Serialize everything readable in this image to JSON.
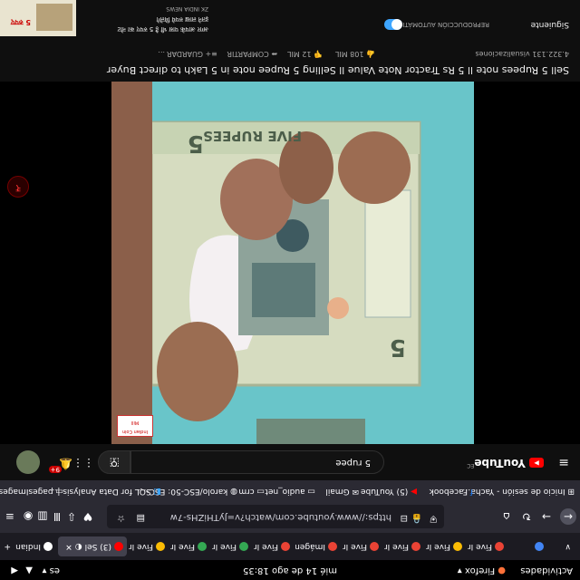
{
  "topbar": {
    "activities": "Actividades",
    "app_name": "Firefox",
    "clock": "mié 14 de ago  18:35",
    "keyboard": "es"
  },
  "tabs": [
    {
      "label": "Five India",
      "color": "#ea4335"
    },
    {
      "label": "Five India",
      "color": "#fbbc04"
    },
    {
      "label": "Five India",
      "color": "#ea4335"
    },
    {
      "label": "Five India",
      "color": "#ea4335"
    },
    {
      "label": "Imágenes",
      "color": "#ea4335"
    },
    {
      "label": "Five India",
      "color": "#ea4335"
    },
    {
      "label": "Five India",
      "color": "#34a853"
    },
    {
      "label": "Five India",
      "color": "#34a853"
    },
    {
      "label": "Five India",
      "color": "#fbbc04"
    },
    {
      "label": "(3) Sel",
      "color": "#ff0000"
    },
    {
      "label": "Indian rupee",
      "color": "#ffffff"
    }
  ],
  "navbar": {
    "url": "https://www.youtube.com/watch?v=JyTHiZHs-7w"
  },
  "bookmarks": [
    "Inicio de sesión - Yacha…",
    "Facebook",
    "(5) YouTube",
    "Gmail",
    "audio_net",
    "crm",
    "karolo/ESC-50: ESC-…",
    "SQL for Data Analysis |…",
    "pagesImages"
  ],
  "youtube": {
    "logo": "YouTube",
    "country": "EC",
    "search_value": "5 rupee",
    "notification_count": "9+"
  },
  "video": {
    "watermark": "Indian Coin Mill",
    "note_text": "FIVE RUPEES",
    "note_numeral": "5",
    "title": "Sell 5 Rupees note ll 5 Rs Tractor Note Value ll Selling 5 Rupee note in 5 Lakh to direct Buyer",
    "views": "4.322.131 visualizaciones",
    "likes": "108 MIL",
    "dislikes": "12 MIL",
    "share": "COMPARTIR",
    "save": "GUARDAR",
    "more": "..."
  },
  "sidebar": {
    "next_label": "Siguiente",
    "autoplay_label": "REPRODUCCIÓN AUTOMÁTICA",
    "next_channel": "ZK INDIA NEWS",
    "next_title_line1": "अगर आपके पास भी है 5 रुपए का नोट",
    "next_title_line2": "इतने लाख रुपये मिलेंगे",
    "thumb_text": "5 रुपए"
  }
}
